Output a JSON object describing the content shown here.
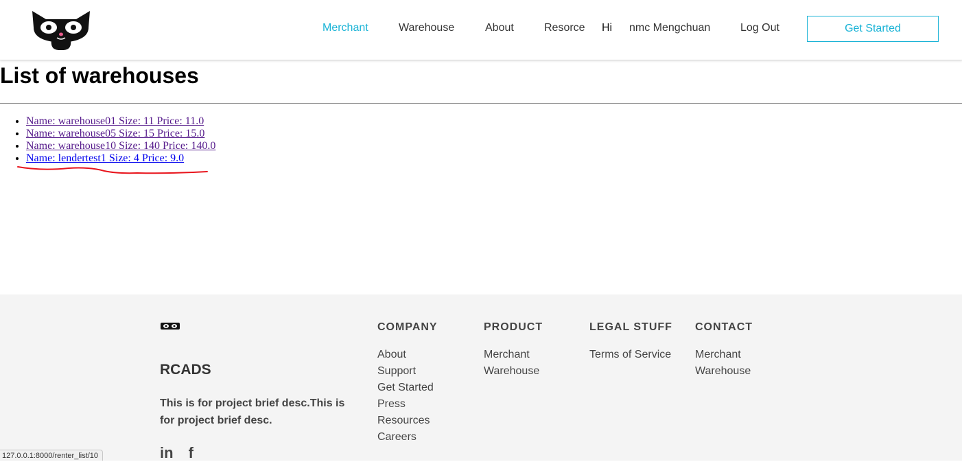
{
  "header": {
    "nav": [
      {
        "label": "Merchant",
        "active": true
      },
      {
        "label": "Warehouse"
      },
      {
        "label": "About"
      },
      {
        "label": "Resorce"
      }
    ],
    "greeting": "Hi",
    "username": "nmc Mengchuan",
    "logout_label": "Log Out",
    "cta_label": "Get Started",
    "accent_color": "#1ab3d6"
  },
  "main": {
    "title": "List of warehouses",
    "warehouses": [
      "Name: warehouse01 Size: 11 Price: 11.0",
      "Name: warehouse05 Size: 15 Price: 15.0",
      "Name: warehouse10 Size: 140 Price: 140.0",
      "Name: lendertest1 Size: 4 Price: 9.0"
    ],
    "visited_link_color": "#551a8b",
    "link_color": "#0000ee",
    "annotation_color": "#e8141c"
  },
  "footer": {
    "brand": "RCADS",
    "description": "This is for project brief desc.This is for project brief desc.",
    "columns": [
      {
        "heading": "COMPANY",
        "links": [
          "About",
          "Support",
          "Get Started",
          "Press",
          "Resources",
          "Careers"
        ]
      },
      {
        "heading": "PRODUCT",
        "links": [
          "Merchant",
          "Warehouse"
        ]
      },
      {
        "heading": "LEGAL STUFF",
        "links": [
          "Terms of Service"
        ]
      },
      {
        "heading": "CONTACT",
        "links": [
          "Merchant",
          "Warehouse"
        ]
      }
    ],
    "social": [
      "in",
      "f"
    ]
  },
  "status_bar": {
    "url": "127.0.0.1:8000/renter_list/10"
  }
}
